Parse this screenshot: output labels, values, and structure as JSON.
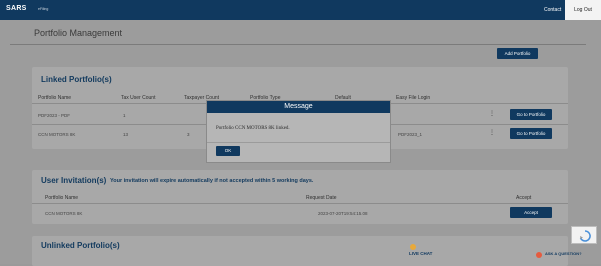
{
  "header": {
    "logo": "SARS",
    "logo_sub": "eFiling",
    "contact": "Contact",
    "logout": "Log Out"
  },
  "page_title": "Portfolio Management",
  "add_portfolio": "Add Portfolio",
  "linked": {
    "title": "Linked Portfolio(s)",
    "columns": [
      "Portfolio Name",
      "Tax User Count",
      "Taxpayer Count",
      "Portfolio Type",
      "Default",
      "Easy File Login"
    ],
    "rows": [
      {
        "name": "PDF2023 - PDF",
        "tax_user_count": "1",
        "taxpayer_count": "",
        "login": "",
        "action": "Go to Portfolio"
      },
      {
        "name": "CCN MOTORS 8K",
        "tax_user_count": "13",
        "taxpayer_count": "3",
        "login": "PDF2023_1",
        "action": "Go to Portfolio"
      }
    ]
  },
  "invitation": {
    "title": "User Invitation(s)",
    "notice": "Your invitation will expire automatically if not accepted within 5 working days.",
    "columns": [
      "Portfolio Name",
      "Request Date",
      "Accept"
    ],
    "rows": [
      {
        "name": "CCN MOTORS 8K",
        "date": "2023-07-20T19:54:15.08",
        "action": "Accept"
      }
    ]
  },
  "unlinked": {
    "title": "Unlinked Portfolio(s)"
  },
  "modal": {
    "title": "Message",
    "message": "Portfolio CCN MOTORS 8K linked.",
    "ok": "OK"
  },
  "footer": {
    "live_chat": "LIVE CHAT",
    "ask_question": "ASK A QUESTION?"
  }
}
